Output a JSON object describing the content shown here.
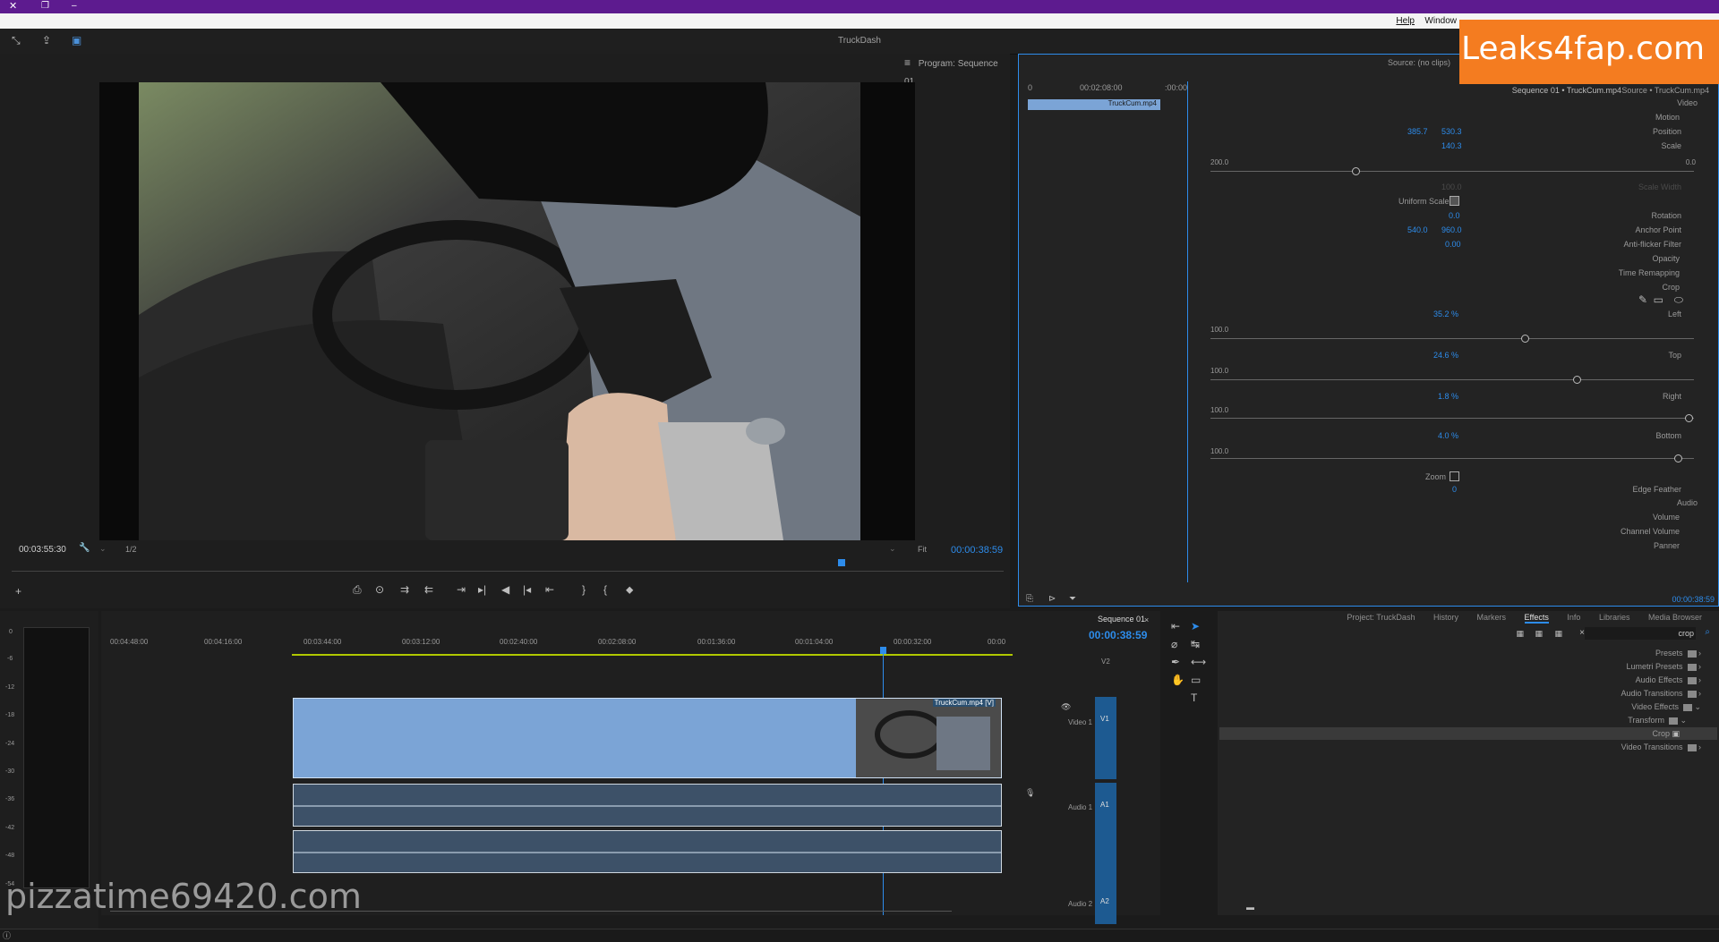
{
  "window": {
    "title": "TruckDash"
  },
  "menu": {
    "items": [
      "Help",
      "Window"
    ]
  },
  "program_monitor": {
    "title": "Program: Sequence 01",
    "timecode_current": "00:00:38:59",
    "timecode_duration": "00:03:55:30",
    "fit": "Fit",
    "resolution": "1/2"
  },
  "source_panel": {
    "source_title": "Source: (no clips)",
    "clip_path": "Source • TruckCum.mp4",
    "seq_path": "Sequence 01 • TruckCum.mp4",
    "mini_clip_label": "TruckCum.mp4",
    "mini_time_start": ":00:00",
    "mini_time_mid": "00:02:08:00",
    "mini_time_end": "0",
    "footer_timecode": "00:00:38:59"
  },
  "effect_controls": {
    "video_header": "Video",
    "motion": "Motion",
    "position": {
      "label": "Position",
      "x": "530.3",
      "y": "385.7"
    },
    "scale": {
      "label": "Scale",
      "value": "140.3",
      "min": "0.0",
      "max": "200.0"
    },
    "scale_width": {
      "label": "Scale Width",
      "value": "100.0"
    },
    "uniform_scale": "Uniform Scale",
    "rotation": {
      "label": "Rotation",
      "value": "0.0"
    },
    "anchor_point": {
      "label": "Anchor Point",
      "x": "960.0",
      "y": "540.0"
    },
    "anti_flicker": {
      "label": "Anti-flicker Filter",
      "value": "0.00"
    },
    "opacity": "Opacity",
    "time_remapping": "Time Remapping",
    "crop": "Crop",
    "left": {
      "label": "Left",
      "value": "35.2 %",
      "min": "0.0",
      "max": "100.0"
    },
    "top": {
      "label": "Top",
      "value": "24.6 %",
      "min": "0.0",
      "max": "100.0"
    },
    "right": {
      "label": "Right",
      "value": "1.8 %",
      "min": "0.0",
      "max": "100.0"
    },
    "bottom": {
      "label": "Bottom",
      "value": "4.0 %",
      "min": "0.0",
      "max": "100.0"
    },
    "zoom": "Zoom",
    "edge_feather": {
      "label": "Edge Feather",
      "value": "0"
    },
    "audio_header": "Audio",
    "volume": "Volume",
    "channel_volume": "Channel Volume",
    "panner": "Panner"
  },
  "timeline": {
    "sequence_tab": "Sequence 01",
    "timecode": "00:00:38:59",
    "ruler": [
      "00:00",
      "00:00:32:00",
      "00:01:04:00",
      "00:01:36:00",
      "00:02:08:00",
      "00:02:40:00",
      "00:03:12:00",
      "00:03:44:00",
      "00:04:16:00",
      "00:04:48:00"
    ],
    "tracks": {
      "v2": "V2",
      "v1": "V1",
      "video1": "Video 1",
      "a1": "A1",
      "audio1": "Audio 1",
      "a2": "A2",
      "audio2": "Audio 2"
    },
    "clip_label": "TruckCum.mp4 [V]",
    "meter_scale": [
      "0",
      "-6",
      "-12",
      "-18",
      "-24",
      "-30",
      "-36",
      "-42",
      "-48",
      "-54"
    ]
  },
  "effects_panel": {
    "tabs": [
      "Media Browser",
      "Libraries",
      "Info",
      "Effects",
      "Markers",
      "History",
      "Project: TruckDash"
    ],
    "active_tab": "Effects",
    "search_value": "crop",
    "items": [
      "Presets",
      "Lumetri Presets",
      "Audio Effects",
      "Audio Transitions",
      "Video Effects",
      "Transform",
      "Crop",
      "Video Transitions"
    ]
  },
  "watermarks": {
    "top_right": "Leaks4fap.com",
    "bottom_left": "pizzatime69420.com"
  }
}
